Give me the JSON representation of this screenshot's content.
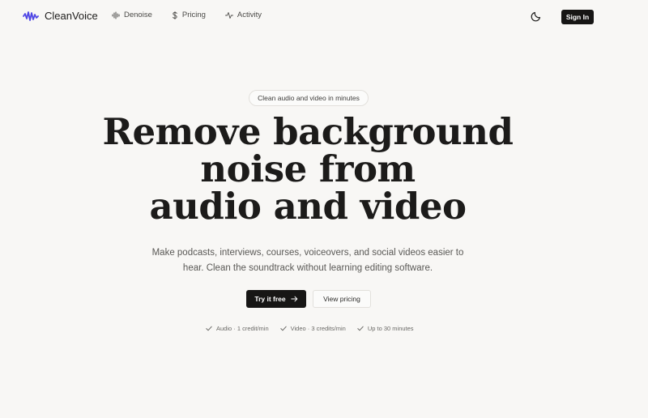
{
  "brand": {
    "name": "CleanVoice",
    "logo_icon": "waveform-icon",
    "accent_color": "#4f46e5"
  },
  "nav": {
    "items": [
      {
        "label": "Denoise",
        "icon": "audio-lines-icon"
      },
      {
        "label": "Pricing",
        "icon": "dollar-icon"
      },
      {
        "label": "Activity",
        "icon": "activity-icon"
      }
    ],
    "theme_icon": "moon-icon",
    "signin_label": "Sign In"
  },
  "hero": {
    "badge": "Clean audio and video in minutes",
    "headline_lines": [
      "Remove background",
      "noise from",
      "audio and video"
    ],
    "subtitle_lines": [
      "Make podcasts, interviews, courses, voiceovers, and social videos easier to",
      "hear. Clean the soundtrack without learning editing software."
    ],
    "primary_cta": "Try it free",
    "secondary_cta": "View pricing",
    "features": [
      "Audio · 1 credit/min",
      "Video · 3 credits/min",
      "Up to 30 minutes"
    ]
  }
}
